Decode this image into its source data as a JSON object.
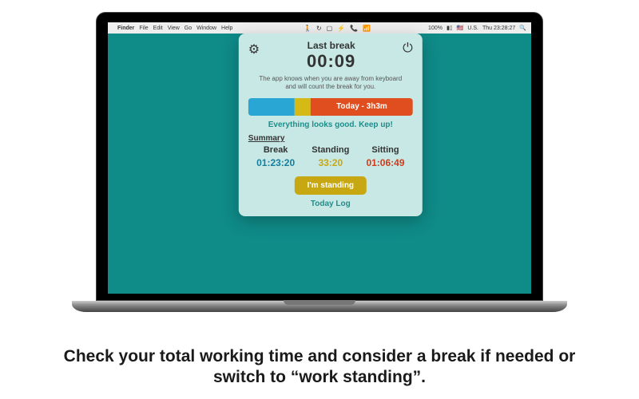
{
  "menubar": {
    "apple": "",
    "app": "Finder",
    "items": [
      "File",
      "Edit",
      "View",
      "Go",
      "Window",
      "Help"
    ],
    "battery": "100%",
    "flag": "🇺🇸",
    "locale": "U.S.",
    "clock": "Thu 23:28:27",
    "search": "🔍"
  },
  "tray_icons": [
    "🚶",
    "↻",
    "▢",
    "⚡",
    "📞",
    "📶"
  ],
  "popover": {
    "gear": "⚙",
    "power": "⏻",
    "last_break_label": "Last break",
    "last_break_time": "00:09",
    "description": "The app knows when you are away from keyboard and will count the break for you.",
    "bar_label": "Today - 3h3m",
    "status": "Everything looks good. Keep up!",
    "summary_heading": "Summary",
    "cols": {
      "break": {
        "h": "Break",
        "v": "01:23:20"
      },
      "standing": {
        "h": "Standing",
        "v": "33:20"
      },
      "sitting": {
        "h": "Sitting",
        "v": "01:06:49"
      }
    },
    "standing_button": "I'm standing",
    "today_log": "Today Log"
  },
  "caption": "Check your total working time and consider a break if needed or switch to “work standing”."
}
